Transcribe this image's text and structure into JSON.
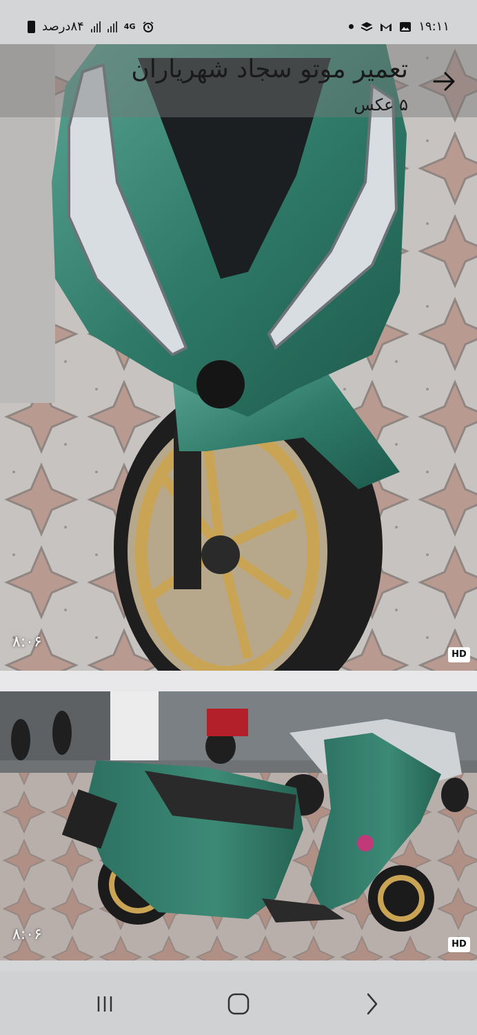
{
  "status_bar": {
    "battery_text": "۸۴درصد",
    "network": "4G",
    "time": "۱۹:۱۱"
  },
  "listing": {
    "title": "تعمیر موتو سجاد شهریاران",
    "photo_count": "۵ عکس"
  },
  "media": [
    {
      "duration": "۸:۰۶",
      "badge": "HD"
    },
    {
      "duration": "۸:۰۶",
      "badge": "HD"
    }
  ],
  "icons": {
    "status_left": [
      "battery-icon",
      "signal-icon",
      "signal-icon",
      "network-4g-icon",
      "alarm-icon"
    ],
    "status_right": [
      "notification-dot-icon",
      "layers-icon",
      "gmail-icon",
      "gallery-icon"
    ],
    "header_action": "arrow-right-icon",
    "nav": [
      "recent-apps-icon",
      "home-icon",
      "back-icon"
    ]
  },
  "colors": {
    "scooter_green": "#2f7a68",
    "rim_gold": "#c9a455"
  }
}
